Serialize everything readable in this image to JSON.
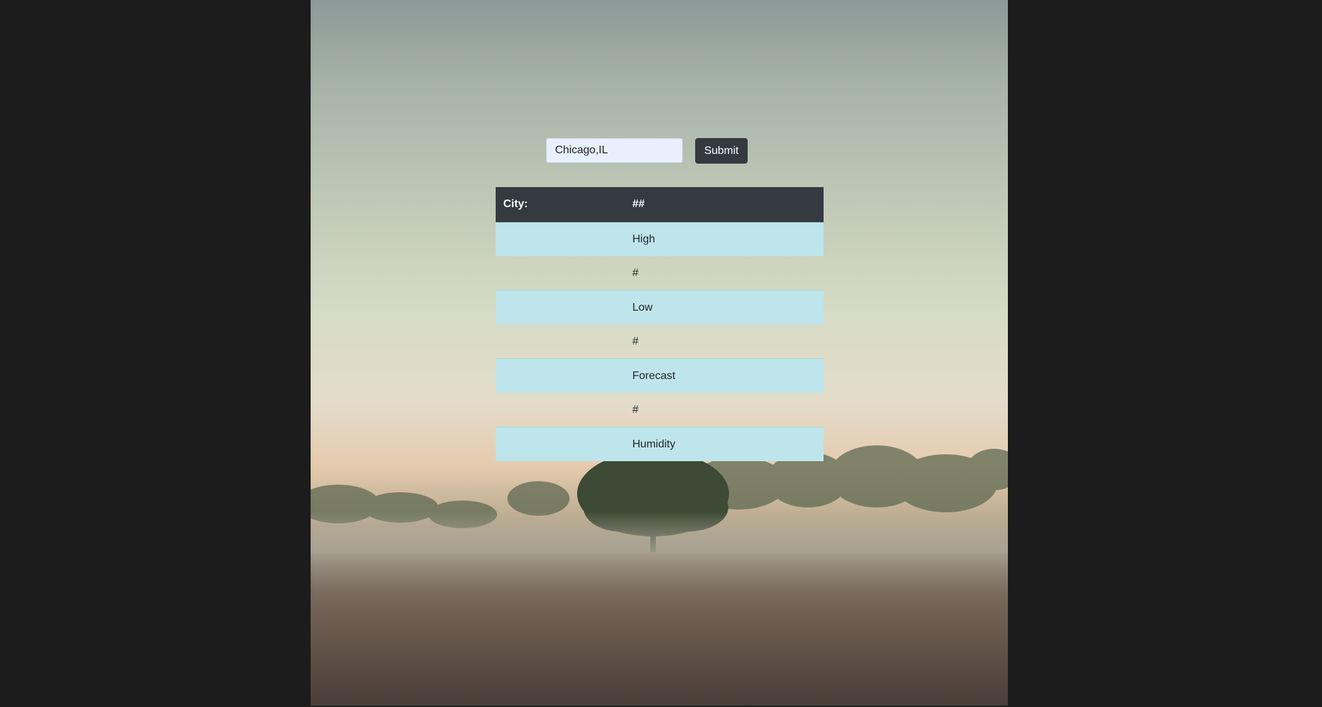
{
  "search": {
    "value": "Chicago,IL",
    "submit_label": "Submit"
  },
  "table": {
    "header": [
      "City:",
      "##"
    ],
    "rows": [
      {
        "label": "",
        "value": "High"
      },
      {
        "label": "",
        "value": "#"
      },
      {
        "label": "",
        "value": "Low"
      },
      {
        "label": "",
        "value": "#"
      },
      {
        "label": "",
        "value": "Forecast"
      },
      {
        "label": "",
        "value": "#"
      },
      {
        "label": "",
        "value": "Humidity"
      }
    ]
  },
  "colors": {
    "page_background": "#1c1c1c",
    "button": "#343a40",
    "table_header": "#343a40",
    "table_info_row": "#bee5eb",
    "input_background": "#e8f0fe"
  },
  "background_image": "misty-field-with-tree"
}
